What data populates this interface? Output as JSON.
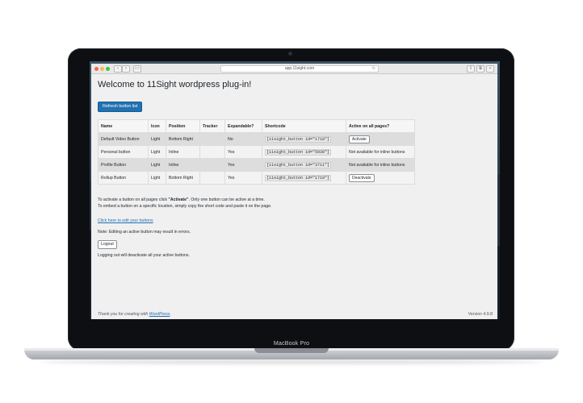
{
  "device": {
    "brand_label": "MacBook Pro"
  },
  "browser": {
    "url": "app.11sight.com",
    "back_glyph": "‹",
    "forward_glyph": "›",
    "sidebar_glyph": "▭",
    "reload_glyph": "↻",
    "share_glyph": "⇪",
    "tabs_glyph": "⧉",
    "new_tab_glyph": "+"
  },
  "page": {
    "title": "Welcome to 11Sight wordpress plug-in!",
    "refresh_button": "Refresh button list",
    "table": {
      "headers": [
        "Name",
        "Icon",
        "Position",
        "Tracker",
        "Expandable?",
        "Shortcode",
        "Active on all pages?"
      ],
      "rows": [
        {
          "name": "Default Video Button",
          "icon": "Light",
          "position": "Bottom Right",
          "tracker": "",
          "expandable": "No",
          "shortcode": "[11sight_button id=\"1718\"]",
          "active": "Activate",
          "active_is_button": true
        },
        {
          "name": "Personal button",
          "icon": "Light",
          "position": "Inline",
          "tracker": "",
          "expandable": "Yes",
          "shortcode": "[11sight_button id=\"5930\"]",
          "active": "Not available for inline buttons",
          "active_is_button": false
        },
        {
          "name": "Profile Button",
          "icon": "Light",
          "position": "Inline",
          "tracker": "",
          "expandable": "Yes",
          "shortcode": "[11sight_button id=\"3711\"]",
          "active": "Not available for inline buttons",
          "active_is_button": false
        },
        {
          "name": "Rollup Button",
          "icon": "Light",
          "position": "Bottom Right",
          "tracker": "",
          "expandable": "Yes",
          "shortcode": "[11sight_button id=\"1719\"]",
          "active": "Deactivate",
          "active_is_button": true
        }
      ]
    },
    "instructions": {
      "line1_before": "To activate a button on all pages click ",
      "line1_bold": "\"Activate\"",
      "line1_after": ". Only one button can be active at a time.",
      "line2": "To embed a button on a specific location, simply copy the short code and paste it on the page."
    },
    "edit_link": "Click here to edit your buttons",
    "note": "Note: Editing an active button may result in errors.",
    "logout_button": "Logout",
    "logout_note": "Logging out will deactivate all your active buttons.",
    "footer": {
      "thanks_prefix": "Thank you for creating with ",
      "wordpress_link": "WordPress",
      "thanks_suffix": ".",
      "version": "Version 4.9.8"
    }
  },
  "colors": {
    "primary": "#2271b1",
    "page_bg": "#f0f0f1",
    "row_odd": "#dddddd",
    "row_even": "#f3f3f3"
  }
}
